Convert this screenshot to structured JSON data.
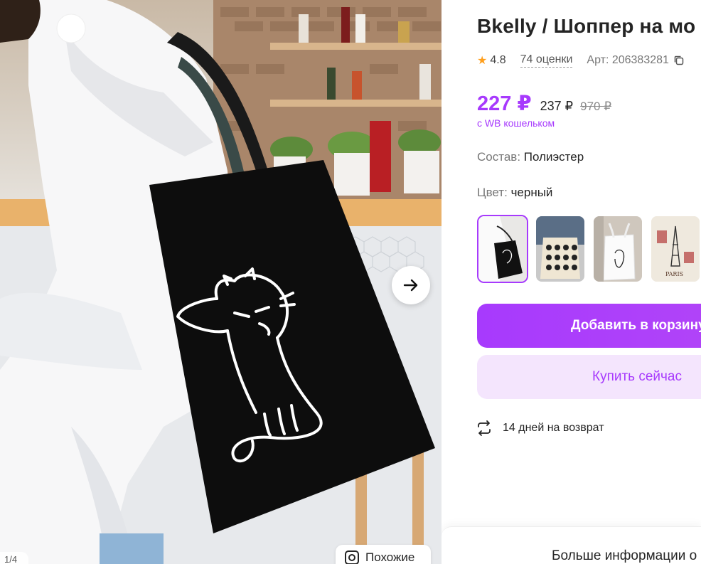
{
  "product": {
    "title": "Bkelly / Шоппер на мо",
    "rating": "4.8",
    "reviews": "74 оценки",
    "article": "Арт: 206383281",
    "price": "227 ₽",
    "price_without_wallet": "237 ₽",
    "price_old": "970 ₽",
    "wallet_note": "с WB кошельком",
    "composition_label": "Состав:",
    "composition_value": "Полиэстер",
    "color_label": "Цвет:",
    "color_value": "черный"
  },
  "gallery": {
    "counter": "1/4",
    "similar_label": "Похожие",
    "thumbnails": [
      "cat-bag-black",
      "faces-bag-beige",
      "cat-bag-white",
      "paris-bag"
    ]
  },
  "actions": {
    "add_to_cart": "Добавить в корзину",
    "buy_now": "Купить сейчас"
  },
  "return_policy": "14 дней на возврат",
  "more_info": "Больше информации о",
  "colors": {
    "accent": "#a73afd",
    "accent_light": "#f4e5fd",
    "star": "#ff9f1c"
  }
}
